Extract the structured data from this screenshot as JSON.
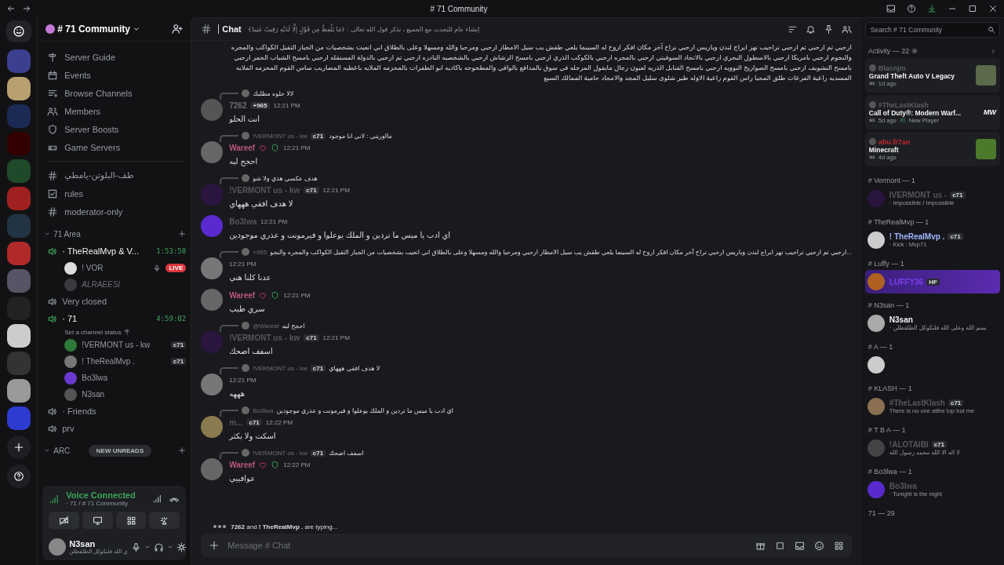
{
  "titlebar": {
    "title": "# 71 Community"
  },
  "server": {
    "name": "# 71 Community"
  },
  "nav": [
    "Server Guide",
    "Events",
    "Browse Channels",
    "Members",
    "Server Boosts",
    "Game Servers"
  ],
  "channels": [
    {
      "name": "طف-البلوتن-يامطي",
      "kind": "text"
    },
    {
      "name": "rules",
      "kind": "rules"
    },
    {
      "name": "moderator-only",
      "kind": "text"
    }
  ],
  "category": {
    "name": "71 Area"
  },
  "voice_channels": [
    {
      "name": "· TheRealMvp & V...",
      "active": true,
      "timer": "1:53:58",
      "users": [
        {
          "name": "! VOR",
          "badge": "LIVE",
          "dimmed": false
        },
        {
          "name": "ALRAEESI",
          "dimmed": true
        }
      ]
    },
    {
      "name": "Very closed",
      "active": false
    },
    {
      "name": "· 71",
      "active": true,
      "timer": "4:59:02",
      "status": "Set a channel status",
      "users": [
        {
          "name": "!VERMONT us - kw",
          "tag": "c71",
          "dimmed": false
        },
        {
          "name": "! TheRealMvp .",
          "tag": "c71",
          "dimmed": false
        },
        {
          "name": "Bo3lwa",
          "dimmed": false
        },
        {
          "name": "N3san",
          "dimmed": false
        }
      ]
    },
    {
      "name": "· Friends",
      "active": false
    },
    {
      "name": "prv",
      "active": false
    }
  ],
  "category_2": {
    "name": "ARC"
  },
  "new_unreads": "NEW UNREADS",
  "voice_panel": {
    "title": "Voice Connected",
    "location": "· 71 / # 71 Community"
  },
  "user_panel": {
    "name": "N3san",
    "status": "ي الله فلنكوكل الطلقطلن"
  },
  "chat": {
    "channel": "Chat",
    "topic": "إنشاء عام للتحدث مع الجميع ، تذكر قول الله تعالى : ﴿مَا يَلْفِظُ مِن قَوْلٍ إِلَّا لَدَيْهِ رَقِيبٌ عَتِيدٌ﴾",
    "intro_text": "ارحبي ثم ارحبي ثم ارحبي تراحيب تهز ابراج لندن وباريس ارحبي تراح آخر مكان افكر اروح له السينما يلعي طقش يب سيل الامطار ارحبي ومرحبا والله ومسهلا وعلى بالطلاق اني اتعيت بشخصيات من الجبار الثقيل الكواكب والمجره والنجوم ارحبي بامريكا ارحبي بالاسطول البحري ارحبي بالاتحاد السوفيتي ارحبي بالمجره ارحبي بالكوكب الذري ارحبي بامسح الرشاش ارحبي بالشخصيه النادره ارحبي ثم ارحبي بالدولة المستقله ارحبي بامسح الشباب الحمر ارحبي بامسح التشويف ارحبي بامسح الصواريخ النوويه ارحبي بامسح القنابل الذريه لعيون رجال مايقول المرجله في سوق بالمدافع بالواقي والمطحوحه باكاديه ابو الطفرات بالمحزمه الملايه باعطيه المضاريب ساس القوم المحزمه الملايه المسديه راعية الفزعات طلق المحيا راس القوم راعية الاوله طير شلوى سليل المجد والامجاد حامية الممالك السبع",
    "messages": [
      {
        "reply": {
          "text": "لالا حلوه مطلبك"
        },
        "author": "7262",
        "color": "#6d6f78",
        "tag": "+965",
        "emblems": false,
        "time": "12:21 PM",
        "text": "انت الحلو"
      },
      {
        "reply": {
          "author": "!VERMONT us - kw",
          "tag": "c71",
          "text": "مااوريتي : لاني انا موجود"
        },
        "author": "Wareef",
        "color": "#b8577a",
        "emblems": true,
        "time": "12:21 PM",
        "text": "احجح ليه"
      },
      {
        "reply": {
          "text": "هدف عكسي هذي ولا شو"
        },
        "author": "!VERMONT us - kw",
        "color": "#55565e",
        "tag": "c71",
        "emblems": false,
        "time": "12:21 PM",
        "text": "لا هدف افقي هههاي"
      },
      {
        "author": "Bo3lwa",
        "color": "#55565e",
        "emblems": false,
        "time": "12:21 PM",
        "text": "اي ادب يا ميس ما تردين و الملك يوعلوا و فيرمونت و عذري موجودين"
      },
      {
        "reply": {
          "author": "+965",
          "text": "ارحبي ثم ارحبي تراحيب تهز ابراج لندن وباريس ارحبي تراح آخر مكان افكر اروح له السينما يلعي طقش يب سيل الامطار ارحبي ومرحبا والله ومسهلا وعلى بالطلاق اني اتعيت بشخصيات من الجبار الثقيل الكواكب والمجره والنجو..."
        },
        "emblems": false,
        "time": "12:21 PM",
        "text": "عدنا كلنا هني"
      },
      {
        "author": "Wareef",
        "color": "#b8577a",
        "emblems": true,
        "time": "12:21 PM",
        "text": "سري طيب"
      },
      {
        "reply": {
          "author": "@Wareef",
          "text": "احجح ليه"
        },
        "author": "!VERMONT us - kw",
        "color": "#55565e",
        "tag": "c71",
        "emblems": false,
        "time": "12:21 PM",
        "text": "اسفف اضحك"
      },
      {
        "reply": {
          "author": "!VERMONT us - kw",
          "tag": "c71",
          "text": "لا هدف افقي هههاي"
        },
        "emblems": false,
        "time": "12:21 PM",
        "text": "هههه"
      },
      {
        "reply": {
          "author": "Bo3lwa",
          "text": "اي ادب يا ميس ما تردين و الملك يوعلوا و فيرمونت و عذري موجودين"
        },
        "author": "m...",
        "color": "#55565e",
        "tag": "c71",
        "emblems": false,
        "time": "12:22 PM",
        "text": "اسكت ولا يكثر"
      },
      {
        "reply": {
          "author": "!VERMONT us - kw",
          "tag": "c71",
          "text": "اسفف اضحك"
        },
        "author": "Wareef",
        "color": "#b8577a",
        "emblems": true,
        "time": "12:22 PM",
        "text": "عوافييي"
      }
    ],
    "typing": "**7262** and **! TheRealMvp .** are typing...",
    "composer": {
      "placeholder": "Message # Chat"
    }
  },
  "members": {
    "search_placeholder": "Search # 71 Community",
    "activity_title": "Activity — 22",
    "activities": [
      {
        "user": "Blacnjm",
        "color": "#5c5e66",
        "game": "Grand Theft Auto V Legacy",
        "time": "1d ago"
      },
      {
        "user": "#TheLastKlash",
        "color": "#5c5e66",
        "game": "Call of Duty®: Modern Warf...",
        "time": "5d ago",
        "extra": "New Player",
        "logo": "MW"
      },
      {
        "user": "abu.fr7an",
        "color": "#c0282d",
        "game": "Minecraft",
        "time": "4d ago"
      }
    ],
    "groups": [
      {
        "title": "# Vermont — 1",
        "members": [
          {
            "name": "IVERMONT us -",
            "color": "#55565e",
            "tag": "c71",
            "status": "· Impossible / Impossible",
            "highlight": false
          }
        ]
      },
      {
        "title": "# TheRealMvp — 1",
        "members": [
          {
            "name": "! TheRealMvp .",
            "color": "#9fb6ff",
            "tag": "c71",
            "status": "· Kick : Mvp71",
            "highlight": false
          }
        ]
      },
      {
        "title": "# Luffy — 1",
        "members": [
          {
            "name": "LUFFY36",
            "color": "#7a3ef0",
            "tag": "HF",
            "highlight": true
          }
        ]
      },
      {
        "title": "# N3san — 1",
        "members": [
          {
            "name": "N3san",
            "color": "#f2f3f5",
            "status": "· بسم الله وعلى الله فلنكوكل الطلقطلن",
            "highlight": false
          }
        ]
      },
      {
        "title": "# A — 1",
        "members": [
          {
            "highlight": false
          }
        ]
      },
      {
        "title": "# KLASH — 1",
        "members": [
          {
            "name": "#TheLastKlash",
            "color": "#55565e",
            "tag": "c71",
            "status": "There is no one atthe top but me",
            "highlight": false
          }
        ]
      },
      {
        "title": "# T B A — 1",
        "members": [
          {
            "name": "!ALOTAIBI",
            "color": "#55565e",
            "tag": "c71",
            "status": "لا اله الا الله محمد رسول الله",
            "highlight": false
          }
        ]
      },
      {
        "title": "# Bo3lwa — 1",
        "members": [
          {
            "name": "Bo3lwa",
            "color": "#55565e",
            "status": "· Tonight is the night",
            "highlight": false
          }
        ]
      }
    ],
    "footer_title": "71 — 29"
  }
}
